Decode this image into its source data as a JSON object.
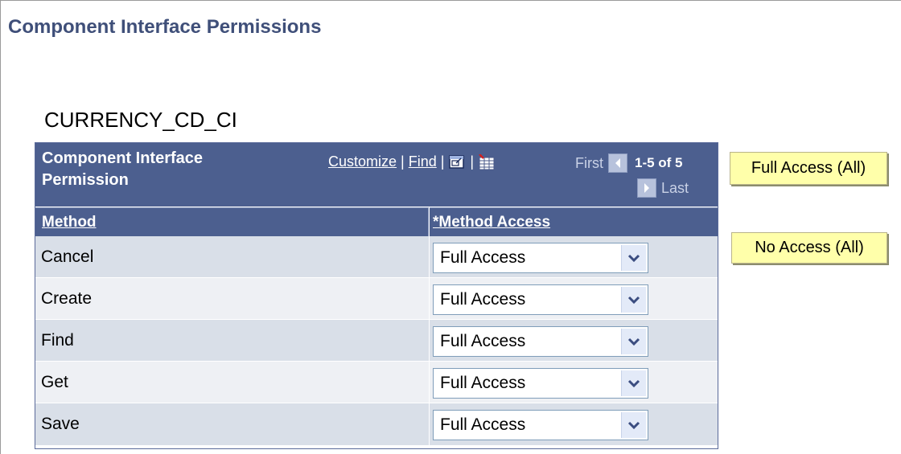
{
  "page": {
    "title": "Component Interface Permissions",
    "component_interface_name": "CURRENCY_CD_CI"
  },
  "grid": {
    "title_line1": "Component Interface",
    "title_line2": "Permission",
    "tools": {
      "customize": "Customize",
      "find": "Find",
      "sep": "|"
    },
    "navigation": {
      "first": "First",
      "count": "1-5 of 5",
      "last": "Last"
    },
    "columns": {
      "method": "Method",
      "method_access": "*Method Access"
    },
    "rows": [
      {
        "method": "Cancel",
        "access": "Full Access"
      },
      {
        "method": "Create",
        "access": "Full Access"
      },
      {
        "method": "Find",
        "access": "Full Access"
      },
      {
        "method": "Get",
        "access": "Full Access"
      },
      {
        "method": "Save",
        "access": "Full Access"
      }
    ]
  },
  "buttons": {
    "full_access_all": "Full Access (All)",
    "no_access_all": "No Access (All)"
  },
  "colors": {
    "header_bg": "#4c5f8f",
    "title_text": "#3f4f79",
    "row_odd": "#d9dfe8",
    "row_even": "#eef0f4",
    "button_bg": "#ffffaa"
  },
  "icons": [
    "zoom-view-icon",
    "download-to-excel-icon",
    "first-arrow-icon",
    "next-arrow-icon",
    "dropdown-arrow-icon"
  ]
}
